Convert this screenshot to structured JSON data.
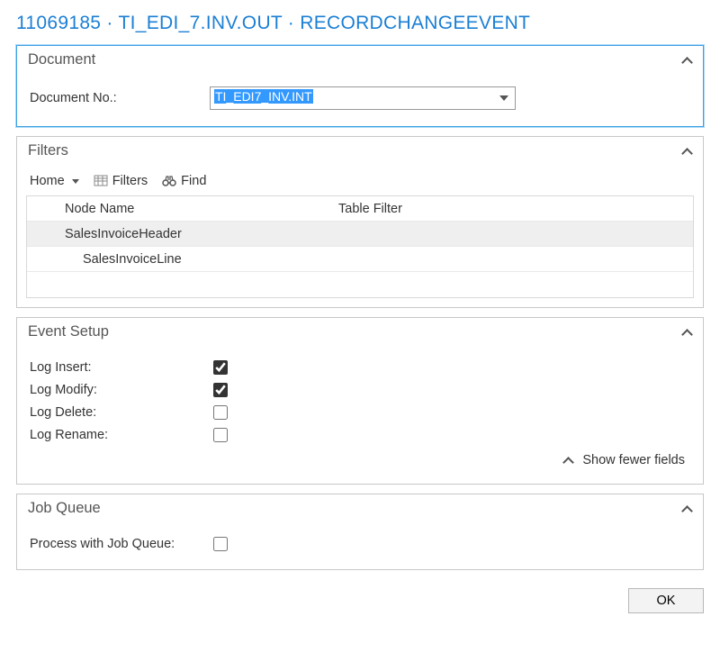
{
  "title": "11069185 · TI_EDI_7.INV.OUT · RECORDCHANGEEVENT",
  "document": {
    "panel_title": "Document",
    "field_label": "Document No.:",
    "value": "TI_EDI7_INV.INT"
  },
  "filters": {
    "panel_title": "Filters",
    "toolbar": {
      "home": "Home",
      "filters": "Filters",
      "find": "Find"
    },
    "columns": {
      "node": "Node Name",
      "filter": "Table Filter"
    },
    "rows": [
      {
        "node": "SalesInvoiceHeader",
        "filter": "",
        "selected": true,
        "indent": false
      },
      {
        "node": "SalesInvoiceLine",
        "filter": "",
        "selected": false,
        "indent": true
      }
    ]
  },
  "event_setup": {
    "panel_title": "Event Setup",
    "log_insert": {
      "label": "Log Insert:",
      "checked": true
    },
    "log_modify": {
      "label": "Log Modify:",
      "checked": true
    },
    "log_delete": {
      "label": "Log Delete:",
      "checked": false
    },
    "log_rename": {
      "label": "Log Rename:",
      "checked": false
    },
    "show_fewer": "Show fewer fields"
  },
  "job_queue": {
    "panel_title": "Job Queue",
    "process_label": "Process with Job Queue:",
    "process_checked": false
  },
  "footer": {
    "ok": "OK"
  }
}
